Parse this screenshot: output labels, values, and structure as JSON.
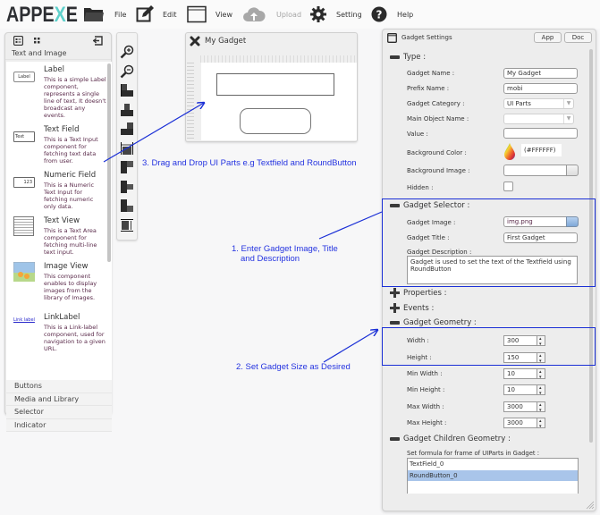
{
  "app": {
    "logo": {
      "prefix": "APPE",
      "x_mark": "X",
      "suffix": "E"
    }
  },
  "toolbar": {
    "items": [
      {
        "label": "File",
        "icon": "folder-icon",
        "enabled": true
      },
      {
        "label": "Edit",
        "icon": "edit-icon",
        "enabled": true
      },
      {
        "label": "View",
        "icon": "window-icon",
        "enabled": true
      },
      {
        "label": "Upload",
        "icon": "cloud-upload-icon",
        "enabled": false
      },
      {
        "label": "Setting",
        "icon": "gear-icon",
        "enabled": true
      },
      {
        "label": "Help",
        "icon": "help-icon",
        "enabled": true
      }
    ]
  },
  "palette": {
    "header_icons": [
      "list-view-icon",
      "grid-view-icon",
      "collapse-panel-icon"
    ],
    "active_category": "Text and Image",
    "components": [
      {
        "title": "Label",
        "icon_text": "Label",
        "description": "This is a simple Label component, represents a single line of text, It doesn't broadcast any events."
      },
      {
        "title": "Text Field",
        "icon_text": "Text",
        "description": "This is a Text Input component for fetching text data from user."
      },
      {
        "title": "Numeric Field",
        "icon_text": "123",
        "description": "This is a Numeric Text Input for fetching numeric only data."
      },
      {
        "title": "Text View",
        "icon_text": "",
        "description": "This is a Text Area component for fetching multi-line text input."
      },
      {
        "title": "Image View",
        "icon_text": "",
        "description": "This component enables to display images from the library of Images."
      },
      {
        "title": "LinkLabel",
        "icon_text": "Link label",
        "description": "This is a Link-label component, used for navigation to a given URL."
      }
    ],
    "groups": [
      "Buttons",
      "Media and Library",
      "Selector",
      "Indicator"
    ]
  },
  "align_toolbar": {
    "tools": [
      "zoom-in-icon",
      "zoom-out-icon",
      "align-left-icon",
      "align-center-icon",
      "align-right-icon",
      "distribute-horizontal-icon",
      "align-top-icon",
      "align-middle-icon",
      "align-bottom-icon",
      "distribute-vertical-icon"
    ]
  },
  "gadget_window": {
    "title": "My Gadget",
    "children": [
      "TextField",
      "RoundButton"
    ]
  },
  "settings": {
    "title": "Gadget Settings",
    "buttons": {
      "app": "App",
      "doc": "Doc"
    },
    "type_section": {
      "label": "Type :",
      "fields": {
        "gadget_name": {
          "label": "Gadget Name :",
          "value": "My Gadget"
        },
        "prefix_name": {
          "label": "Prefix Name :",
          "value": "mobi"
        },
        "gadget_category": {
          "label": "Gadget Category :",
          "value": "UI Parts"
        },
        "main_object_name": {
          "label": "Main Object Name :",
          "value": ""
        },
        "value": {
          "label": "Value :",
          "value": ""
        },
        "background_color": {
          "label": "Background Color :",
          "value": "(#FFFFFF)"
        },
        "background_image": {
          "label": "Background Image :",
          "value": ""
        },
        "hidden": {
          "label": "Hidden :",
          "checked": false
        }
      }
    },
    "selector_section": {
      "label": "Gadget Selector :",
      "gadget_image": {
        "label": "Gadget Image :",
        "value": "img.png"
      },
      "gadget_title": {
        "label": "Gadget Title :",
        "value": "First Gadget"
      },
      "gadget_description": {
        "label": "Gadget Description :",
        "value": "Gadget is used to set the text of the Textfield using RoundButton"
      }
    },
    "properties_label": "Properties :",
    "events_label": "Events :",
    "geometry_section": {
      "label": "Gadget Geometry :",
      "width": {
        "label": "Width :",
        "value": "300"
      },
      "height": {
        "label": "Height :",
        "value": "150"
      },
      "min_width": {
        "label": "Min Width :",
        "value": "10"
      },
      "min_height": {
        "label": "Min Height :",
        "value": "10"
      },
      "max_width": {
        "label": "Max Width :",
        "value": "3000"
      },
      "max_height": {
        "label": "Max Height :",
        "value": "3000"
      }
    },
    "children_section": {
      "label": "Gadget Children Geometry :",
      "hint": "Set formula for frame of UIParts in Gadget :",
      "items": [
        "TextField_0",
        "RoundButton_0"
      ],
      "selected_index": 1
    }
  },
  "annotations": {
    "step1_line1": "1. Enter Gadget Image, Title",
    "step1_line2": "and Description",
    "step2": "2. Set Gadget Size as Desired",
    "step3": "3. Drag and Drop UI Parts e.g Textfield and RoundButton"
  },
  "colors": {
    "annotation": "#2433e0",
    "selected_row": "#a9c5ea",
    "logo_accent": "#5fd1cc"
  }
}
